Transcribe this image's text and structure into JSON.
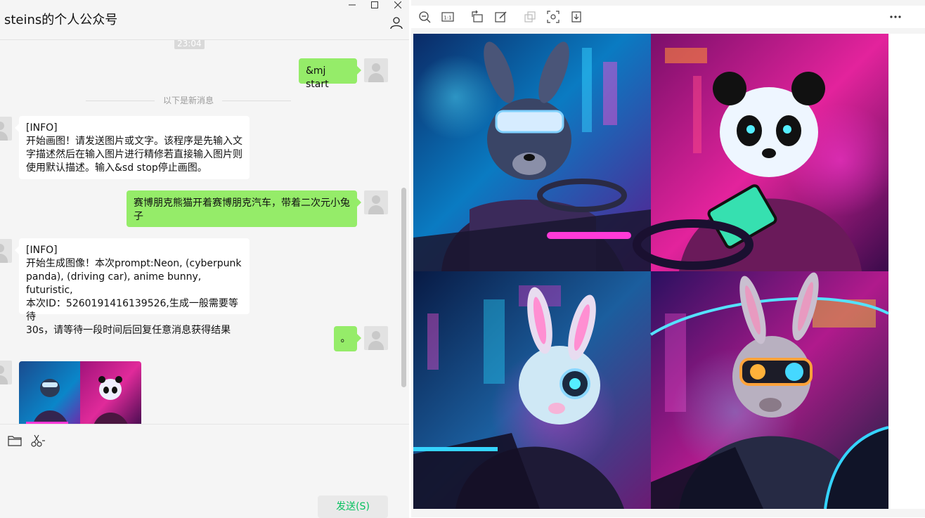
{
  "window": {
    "title": "steins的个人公众号",
    "controls": [
      "minimize",
      "maximize",
      "close"
    ]
  },
  "chat": {
    "timestamp": "23:04",
    "new_messages_divider": "以下是新消息",
    "messages": [
      {
        "side": "right",
        "text": "&mj start"
      },
      {
        "side": "left",
        "text": "[INFO]\n开始画图！请发送图片或文字。该程序是先输入文\n字描述然后在输入图片进行精修若直接输入图片则\n使用默认描述。输入&sd stop停止画图。"
      },
      {
        "side": "right",
        "text": "赛博朋克熊猫开着赛博朋克汽车，带着二次元小兔子"
      },
      {
        "side": "left",
        "text": "[INFO]\n开始生成图像！本次prompt:Neon, (cyberpunk\npanda), (driving car), anime bunny, futuristic,\n本次ID：5260191416139526,生成一般需要等待\n30s，请等待一段时间后回复任意消息获得结果"
      },
      {
        "side": "right",
        "text": "。"
      },
      {
        "side": "left",
        "type": "image"
      }
    ]
  },
  "input": {
    "tools": [
      "folder-icon",
      "scissors-icon"
    ],
    "send_label": "发送(S)"
  },
  "viewer": {
    "toolbar": [
      "zoom-out-icon",
      "actual-size-icon",
      "rotate-icon",
      "edit-icon",
      "copy-icon",
      "screenshot-icon",
      "download-icon",
      "more-icon"
    ],
    "panels": [
      "rabbit-in-car",
      "panda-with-tablet",
      "white-bunny-goggles",
      "rabbit-glowing-goggles"
    ]
  },
  "colors": {
    "self_bubble": "#95ec69",
    "other_bubble": "#ffffff",
    "send_text": "#07c160",
    "neon_pink": "#ff2ad4",
    "neon_cyan": "#22d6ff"
  }
}
